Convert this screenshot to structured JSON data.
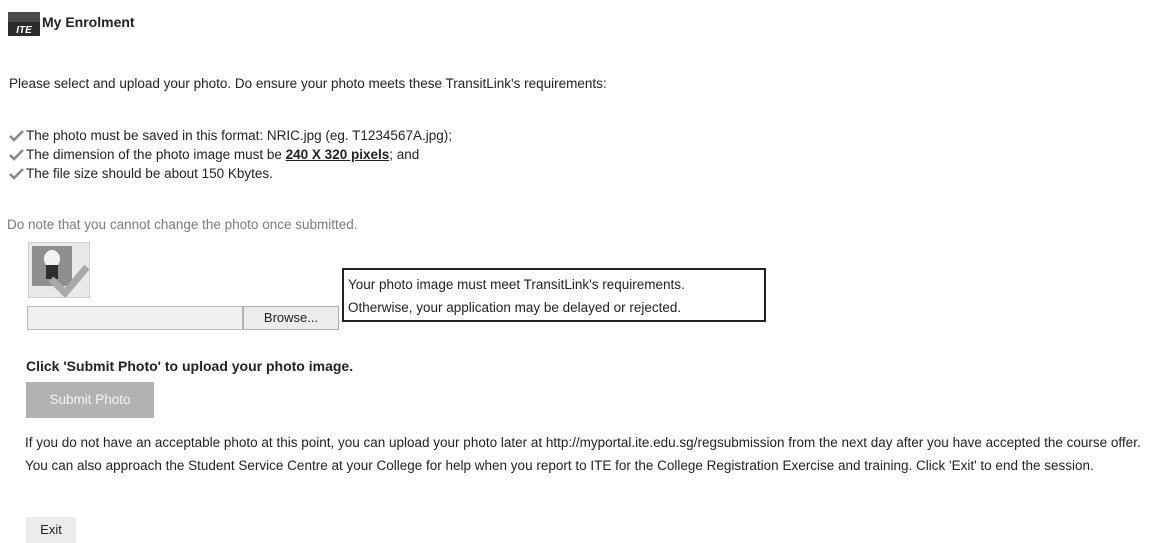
{
  "header": {
    "logo_icon": "ite-logo-icon",
    "logo_text": "ITE",
    "title": "My Enrolment"
  },
  "intro": "Please select and upload your photo. Do ensure your photo meets these TransitLink's requirements:",
  "requirements": {
    "check_icon": "checkmark-icon",
    "item1": "The photo must be saved in this format: NRIC.jpg (eg. T1234567A.jpg);",
    "item2_prefix": "The dimension of the photo image must be ",
    "item2_bold": "240 X 320 pixels",
    "item2_suffix": "; and",
    "item3": "The file size should be about 150 Kbytes."
  },
  "note": "Do note that you cannot change the photo once submitted.",
  "upload": {
    "photo_icon": "photo-placeholder-icon",
    "file_value": "",
    "browse_label": "Browse...",
    "callout_line1": "Your photo image must meet TransitLink's requirements.",
    "callout_line2": "Otherwise, your application may be delayed or rejected."
  },
  "submit": {
    "instruction": "Click 'Submit Photo' to upload your photo image.",
    "button_label": "Submit Photo"
  },
  "help_text": "If you do not have an acceptable photo at this point, you can upload your photo later at http://myportal.ite.edu.sg/regsubmission from the next day after you have accepted the course offer. You can also approach the Student Service Centre at your College for help when you report to ITE for the College Registration Exercise and training. Click 'Exit' to end the session.",
  "exit_label": "Exit",
  "colors": {
    "muted_text": "#7a7a7a",
    "disabled_button": "#b2b2b2",
    "check": "#8a8a8a",
    "logo_dark": "#3a3a3a"
  }
}
